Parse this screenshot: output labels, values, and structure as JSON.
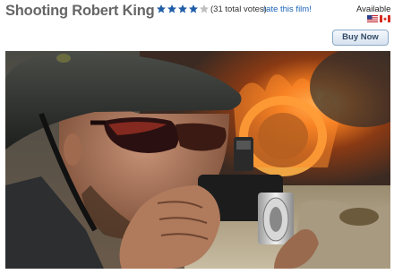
{
  "film": {
    "title": "Shooting Robert King",
    "rating": 4,
    "max_rating": 5,
    "votes_text": "(31 total votes)",
    "rate_link": "rate this film!",
    "availability_label": "Available",
    "flags": [
      "us-flag-icon",
      "ca-flag-icon"
    ],
    "buy_label": "Buy Now"
  },
  "colors": {
    "title": "#666666",
    "star_filled": "#1f5da8",
    "star_empty": "#bfbfbf",
    "link": "#1a63b8"
  },
  "still": {
    "icon": "film-still-image"
  }
}
